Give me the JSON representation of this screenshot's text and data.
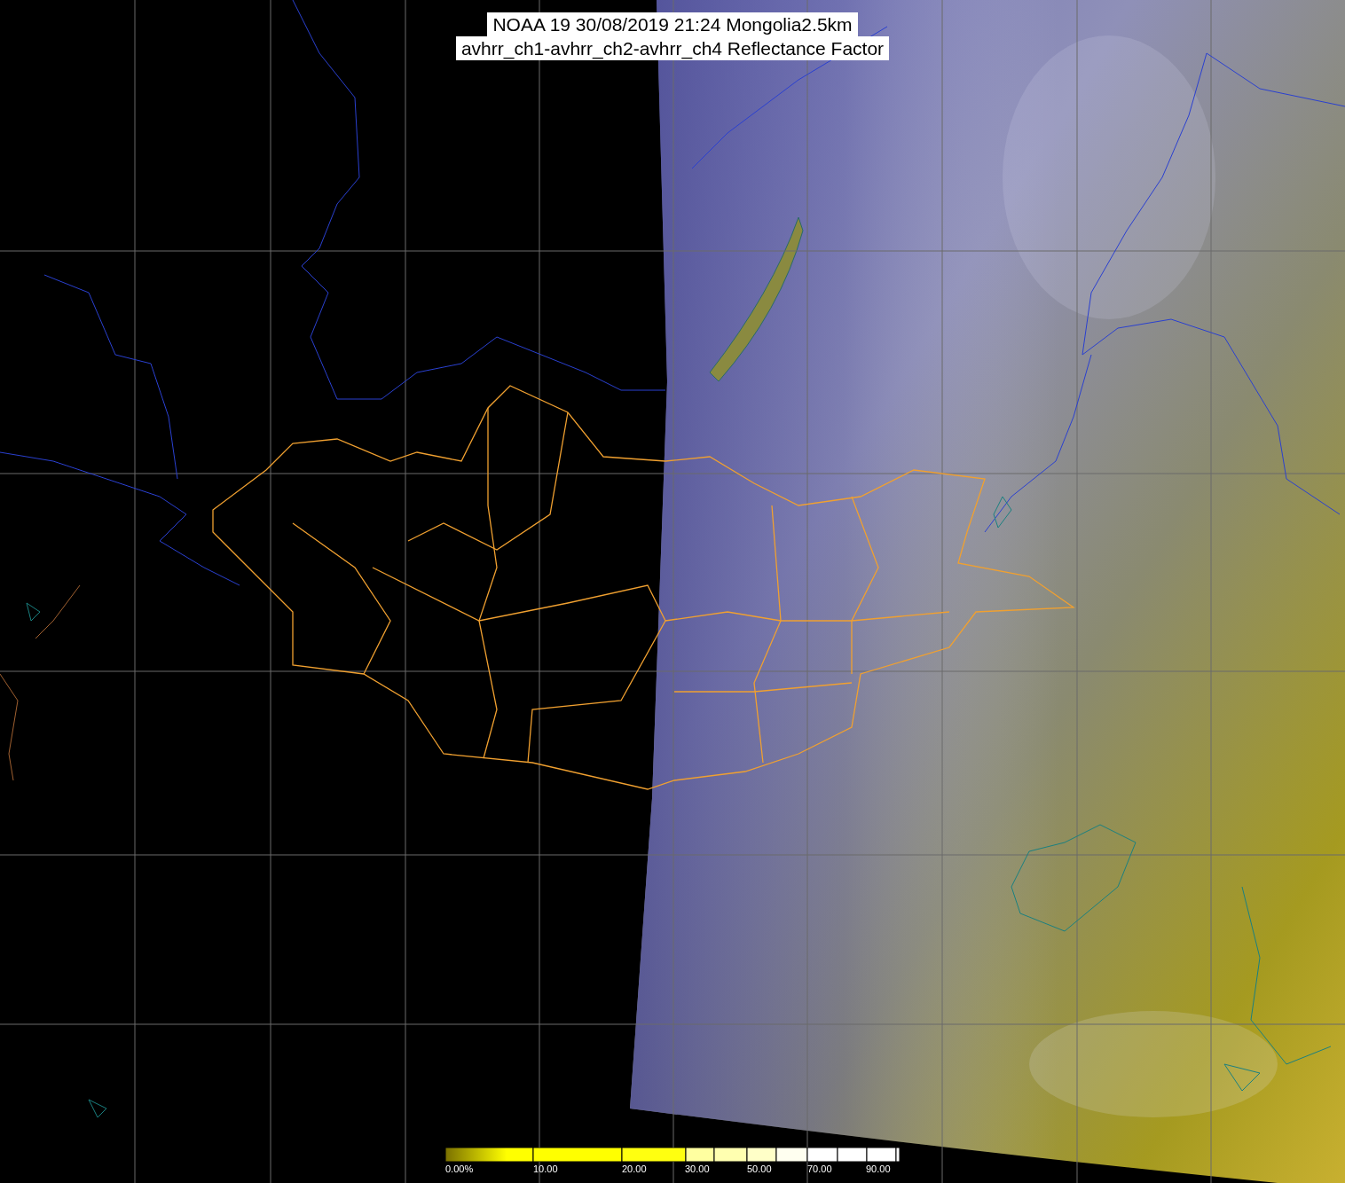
{
  "title": {
    "lines": [
      "NOAA 19 30/08/2019 21:24 Mongolia2.5km",
      "avhrr_ch1-avhrr_ch2-avhrr_ch4 Reflectance Factor"
    ]
  },
  "colorbar": {
    "ticks": [
      "0.00%",
      "10.00",
      "20.00",
      "30.00",
      "50.00",
      "70.00",
      "90.00"
    ]
  }
}
